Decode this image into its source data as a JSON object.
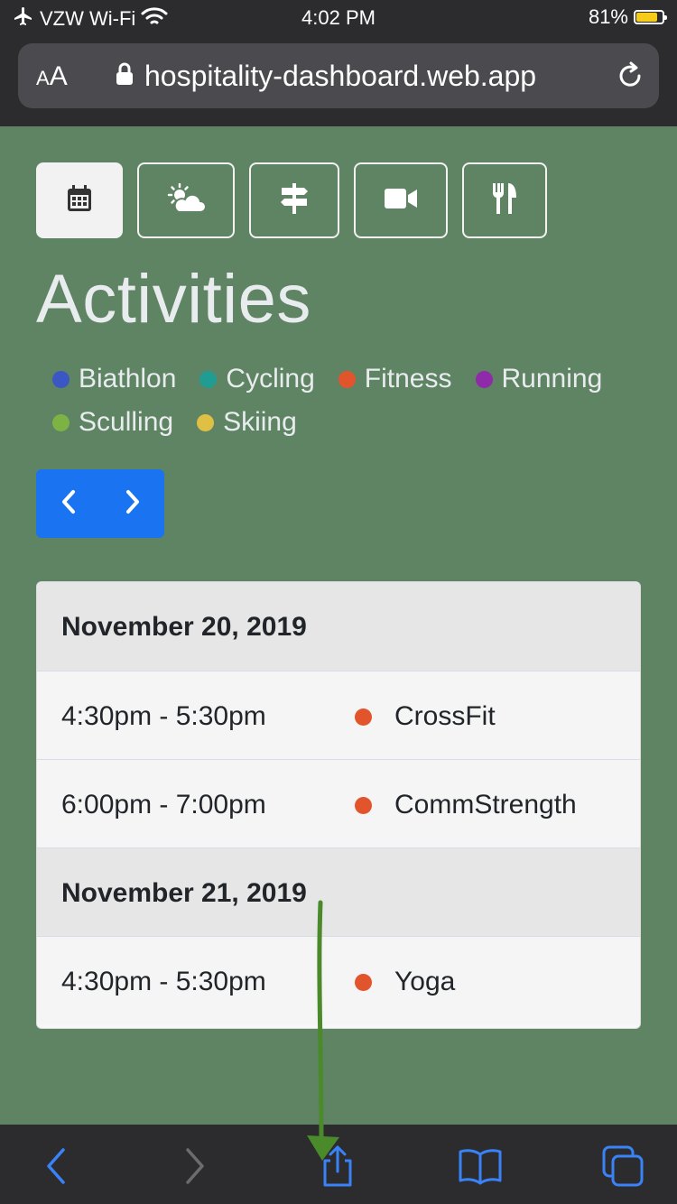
{
  "status_bar": {
    "carrier": "VZW Wi-Fi",
    "time": "4:02 PM",
    "battery_percent": "81%",
    "battery_level": 0.81,
    "icons": [
      "airplane-icon",
      "wifi-icon",
      "battery-icon"
    ]
  },
  "address_bar": {
    "text_size_small": "A",
    "text_size_large": "A",
    "url": "hospitality-dashboard.web.app",
    "icons": [
      "lock-icon",
      "reload-icon"
    ]
  },
  "category_buttons": [
    {
      "icon": "calendar-icon",
      "active": true
    },
    {
      "icon": "cloud-sun-icon",
      "active": false
    },
    {
      "icon": "signpost-icon",
      "active": false
    },
    {
      "icon": "video-camera-icon",
      "active": false
    },
    {
      "icon": "utensils-icon",
      "active": false
    }
  ],
  "page": {
    "title": "Activities"
  },
  "legend": [
    {
      "label": "Biathlon",
      "color": "#3b57c4"
    },
    {
      "label": "Cycling",
      "color": "#219c93"
    },
    {
      "label": "Fitness",
      "color": "#e2542b"
    },
    {
      "label": "Running",
      "color": "#8f2aa8"
    },
    {
      "label": "Sculling",
      "color": "#7db344"
    },
    {
      "label": "Skiing",
      "color": "#e0c044"
    }
  ],
  "pager": {
    "prev_icon": "chevron-left-icon",
    "next_icon": "chevron-right-icon",
    "color": "#1a73f0"
  },
  "schedule": [
    {
      "date": "November 20, 2019",
      "events": [
        {
          "time": "4:30pm - 5:30pm",
          "name": "CrossFit",
          "color": "#e2542b"
        },
        {
          "time": "6:00pm - 7:00pm",
          "name": "CommStrength",
          "color": "#e2542b"
        }
      ]
    },
    {
      "date": "November 21, 2019",
      "events": [
        {
          "time": "4:30pm - 5:30pm",
          "name": "Yoga",
          "color": "#e2542b"
        }
      ]
    }
  ],
  "toolbar": {
    "icons": [
      "back-icon",
      "forward-icon",
      "share-icon",
      "bookmarks-icon",
      "tabs-icon"
    ],
    "accent": "#3a82f7"
  },
  "annotation": {
    "type": "arrow",
    "color": "#4a8a2a",
    "points_to": "share-icon"
  }
}
